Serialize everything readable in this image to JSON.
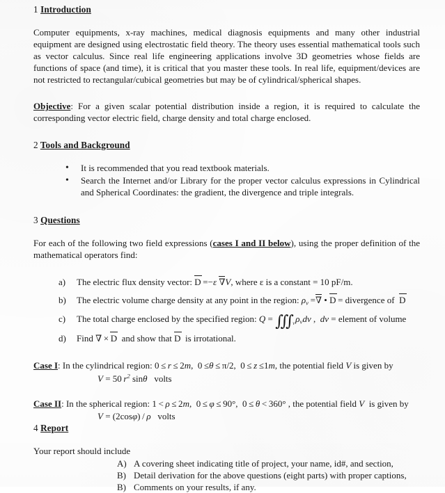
{
  "document": {
    "page_background": "#fdfdfd",
    "text_color": "#1a1a1a"
  },
  "sections": {
    "intro": {
      "number": "1",
      "title": "Introduction",
      "paragraph": "Computer equipments, x-ray machines, medical diagnosis equipments and many other industrial equipment are designed using electrostatic field theory.  The theory uses essential mathematical tools such as vector calculus.    Since real life engineering applications involve 3D geometries whose fields are functions of space (and time), it is critical that you master these tools.  In real life, equipment/devices are not restricted to rectangular/cubical geometries but may be of cylindrical/spherical shapes."
    },
    "objective": {
      "label": "Objective",
      "text": ":  For a given scalar potential distribution inside a region, it is required to calculate the corresponding vector electric field, charge density and total charge enclosed."
    },
    "tools": {
      "number": "2",
      "title": "Tools and Background",
      "bullets": [
        "It is recommended that you read textbook materials.",
        "Search the Internet and/or Library for the proper vector calculus expressions in Cylindrical and Spherical Coordinates: the gradient, the divergence and triple integrals."
      ]
    },
    "questions": {
      "number": "3",
      "title": "Questions",
      "intro_before": "For each of the following two field expressions (",
      "intro_emphasis": "cases I and II below",
      "intro_after": "), using the proper definition of the mathematical operators find:",
      "items": [
        {
          "marker": "a)",
          "text_before": "The electric flux density vector:  ",
          "equation": "D̄ = −ε ∇̄V",
          "text_after": ",  where ε is a constant = 10 pF/m."
        },
        {
          "marker": "b)",
          "text_before": "The electric volume charge density at any point in the region:  ",
          "equation": "ρᵥ = ∇̄ • D̄ = divergence of  D̄",
          "text_after": ""
        },
        {
          "marker": "c)",
          "text_before": "The total charge enclosed by the specified region:  ",
          "equation": "Q = ∭ᵥ ρᵥdv ,   dv = element of volume",
          "text_after": ""
        },
        {
          "marker": "d)",
          "text_before": "Find  ",
          "equation": "∇ × D̄",
          "text_after": "  and show that  D̄ is irrotational."
        }
      ]
    },
    "case_one": {
      "label": "Case I",
      "text": ": In the cylindrical region:  0 ≤ r ≤ 2m,  0 ≤ θ ≤ π/2,  0 ≤ z ≤ 1m , the potential field V is given by",
      "equation": "V = 50 r² sinθ   volts",
      "region": {
        "r_min": 0,
        "r_max": 2,
        "r_unit": "m",
        "theta_min": 0,
        "theta_max": "π/2",
        "z_min": 0,
        "z_max": 1,
        "z_unit": "m"
      }
    },
    "case_two": {
      "label": "Case II",
      "text": ": In the spherical region:  1 < ρ ≤ 2m,  0 ≤ φ ≤ 90°,  0 ≤ θ < 360° , the potential field V  is given by",
      "equation": "V = (2cosφ) / ρ   volts",
      "region": {
        "rho_min": 1,
        "rho_max": 2,
        "rho_unit": "m",
        "phi_min": "0°",
        "phi_max": "90°",
        "theta_min": "0°",
        "theta_max": "360°"
      }
    },
    "report": {
      "number": "4",
      "title": "Report",
      "lead": "Your report should include",
      "items": [
        {
          "marker": "A)",
          "text": "A covering sheet indicating title of project, your name, id#, and section,"
        },
        {
          "marker": "B)",
          "text": "Detail derivation for the above questions (eight parts) with proper captions,"
        },
        {
          "marker": "B)",
          "text": "Comments on your results, if any."
        }
      ]
    }
  }
}
